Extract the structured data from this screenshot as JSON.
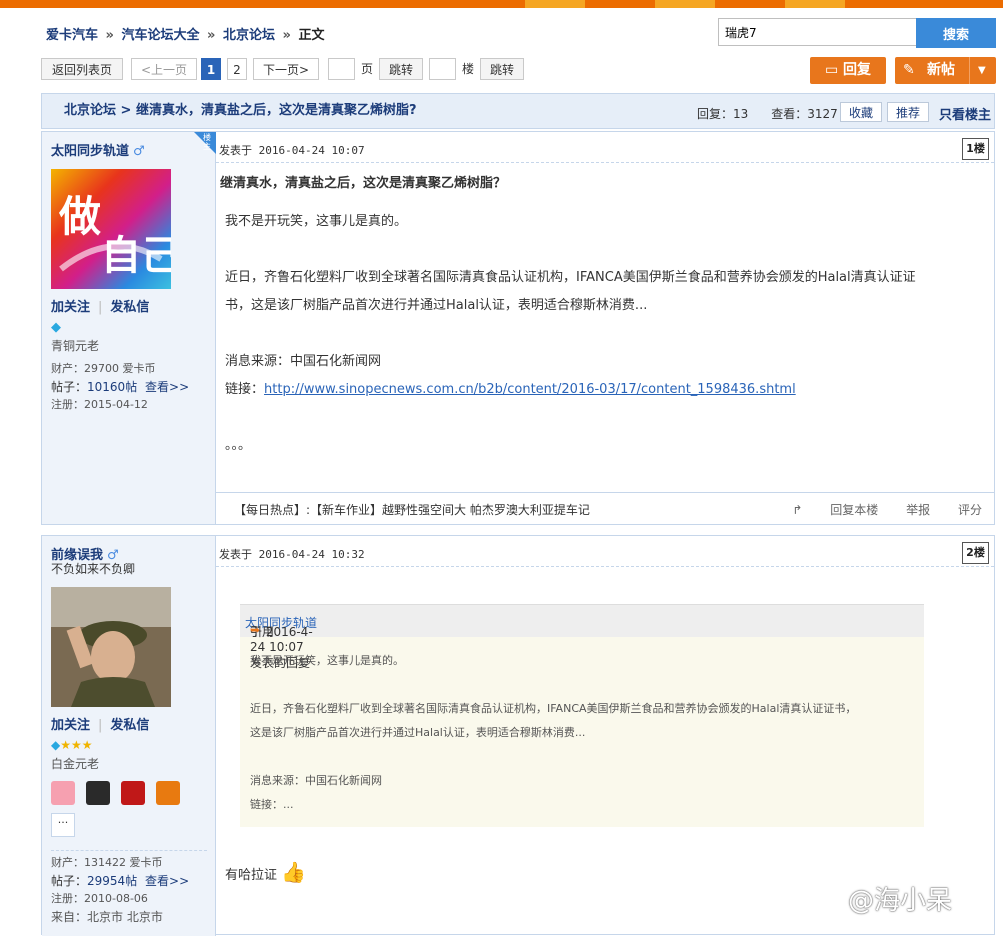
{
  "breadcrumb": {
    "items": [
      "爱卡汽车",
      "汽车论坛大全",
      "北京论坛",
      "正文"
    ],
    "sep": "»"
  },
  "search": {
    "value": "瑞虎7",
    "button": "搜索"
  },
  "pager": {
    "back": "返回列表页",
    "prev": "<上一页",
    "page1": "1",
    "page2": "2",
    "next": "下一页>",
    "page_label": "页",
    "jump": "跳转",
    "floor_label": "楼",
    "jump2": "跳转"
  },
  "actions": {
    "reply": "回复",
    "new_post": "新帖"
  },
  "thread": {
    "forum": "北京论坛",
    "sep": ">",
    "title": "继清真水，清真盐之后，这次是清真聚乙烯树脂?",
    "replies_label": "回复：",
    "replies": "13",
    "views_label": "查看：",
    "views": "3127",
    "fav": "收藏",
    "recommend": "推荐",
    "only_op": "只看楼主"
  },
  "posts": [
    {
      "author": "太阳同步轨道",
      "op_tag": "楼主",
      "follow": "加关注",
      "message": "发私信",
      "rank": "青铜元老",
      "wealth": "财产：29700 爱卡币",
      "posts_label": "帖子：",
      "posts_count": "10160帖",
      "view_more": "查看>>",
      "reg": "注册：2015-04-12",
      "time": "发表于 2016-04-24 10:07",
      "floor": "1楼",
      "headline": "继清真水，清真盐之后，这次是清真聚乙烯树脂？",
      "p1": "我不是开玩笑，这事儿是真的。",
      "p2a": "近日，齐鲁石化塑料厂收到全球著名国际清真食品认证机构，IFANCA美国伊斯兰食品和营养协会颁发的Halal清真认证证",
      "p2b": "书，这是该厂树脂产品首次进行并通过Halal认证，表明适合穆斯林消费...",
      "src": "消息来源：中国石化新闻网",
      "link_label": "链接：",
      "link": "http://www.sinopecnews.com.cn/b2b/content/2016-03/17/content_1598436.shtml",
      "dots": "。。。",
      "hot": "【每日热点】:【新车作业】越野性强空间大 帕杰罗澳大利亚提车记",
      "reply_floor": "回复本楼",
      "report": "举报",
      "rate": "评分"
    },
    {
      "author": "前缘误我",
      "signature": "不负如来不负卿",
      "follow": "加关注",
      "message": "发私信",
      "rank": "白金元老",
      "more": "···",
      "wealth": "财产：131422 爱卡币",
      "posts_label": "帖子：",
      "posts_count": "29954帖",
      "view_more": "查看>>",
      "reg": "注册：2010-08-06",
      "from": "来自：北京市 北京市",
      "time": "发表于 2016-04-24 10:32",
      "floor": "2楼",
      "quote_head_a": "引用",
      "quote_user": "太阳同步轨道",
      "quote_head_b": "于 2016-4-24 10:07 发表的回复",
      "q1": "我不是开玩笑，这事儿是真的。",
      "q2a": "近日，齐鲁石化塑料厂收到全球著名国际清真食品认证机构，IFANCA美国伊斯兰食品和营养协会颁发的Halal清真认证证书，",
      "q2b": "这是该厂树脂产品首次进行并通过Halal认证，表明适合穆斯林消费...",
      "q3": "消息来源：中国石化新闻网",
      "q4": "链接：...",
      "reply_text": "有哈拉证"
    }
  ],
  "watermark": "@海小呆",
  "colors": {
    "orange": "#e8761c",
    "blue": "#2a64b8",
    "link": "#1c3c7a"
  }
}
